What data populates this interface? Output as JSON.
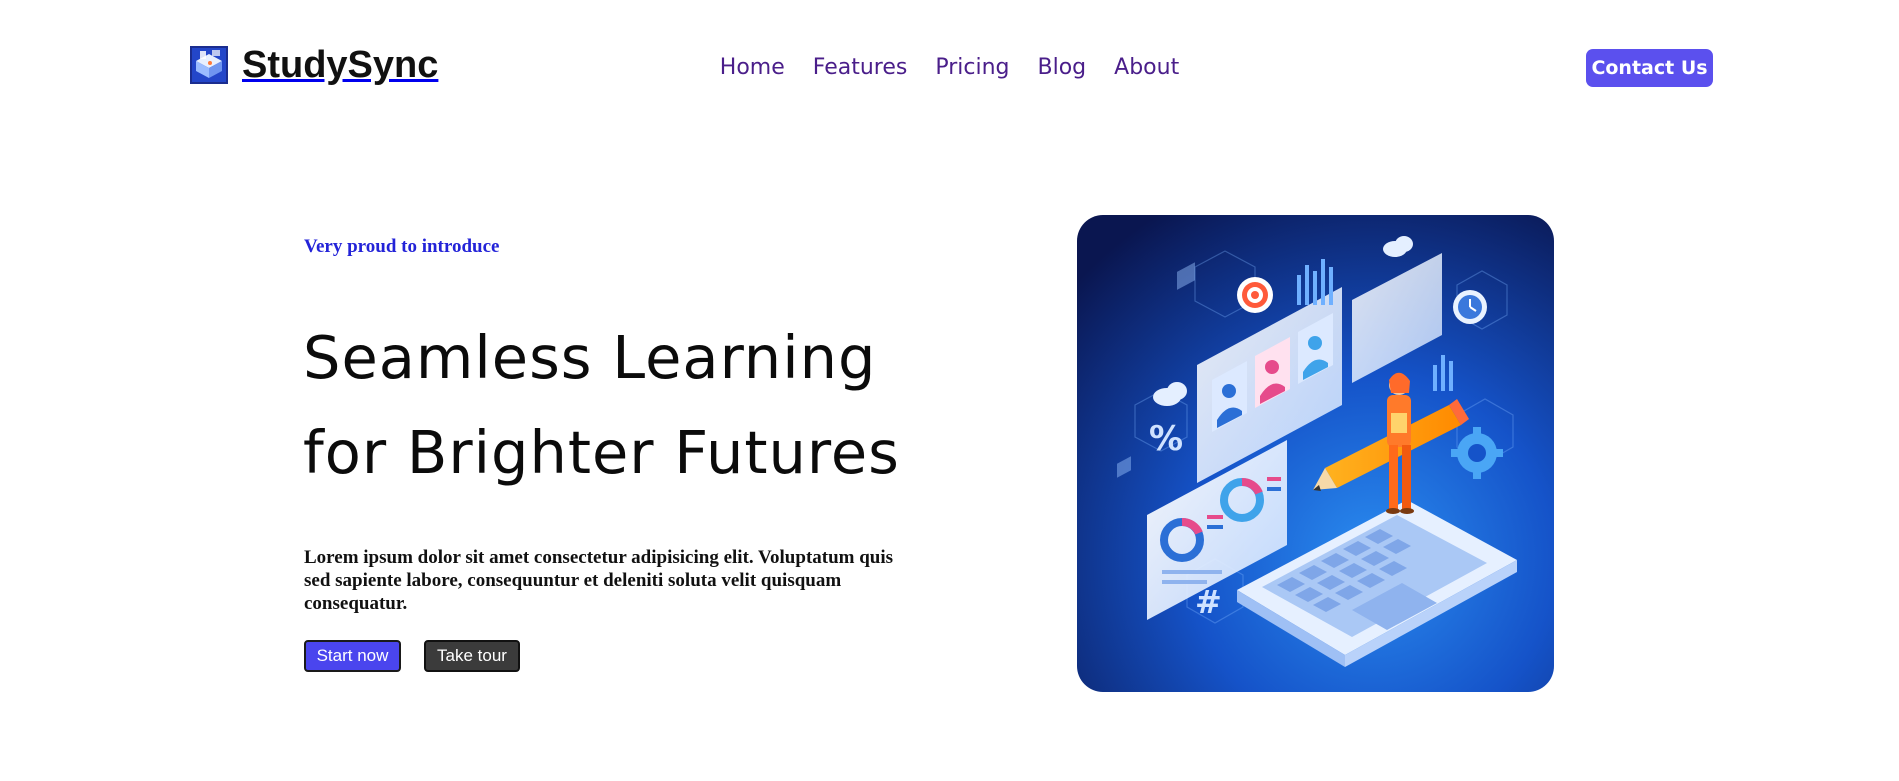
{
  "brand": {
    "name": "StudySync",
    "logo_icon": "isometric-study-app-icon"
  },
  "nav": {
    "items": [
      {
        "label": "Home"
      },
      {
        "label": "Features"
      },
      {
        "label": "Pricing"
      },
      {
        "label": "Blog"
      },
      {
        "label": "About"
      }
    ]
  },
  "header": {
    "contact_label": "Contact Us"
  },
  "hero": {
    "eyebrow": "Very proud to introduce",
    "headline_line1": "Seamless Learning",
    "headline_line2": "for Brighter Futures",
    "lede": "Lorem ipsum dolor sit amet consectetur adipisicing elit. Voluptatum quis sed sapiente labore, consequuntur et deleniti soluta velit quisquam consequatur.",
    "primary_cta": "Start now",
    "secondary_cta": "Take tour",
    "illustration": "isometric-elearning-illustration"
  },
  "colors": {
    "accent": "#5b50ee",
    "nav_text": "#4a1e8a",
    "eyebrow": "#2323d8",
    "hero_bg_dark": "#0b1a5c",
    "hero_bg_light": "#1f7fe6"
  }
}
